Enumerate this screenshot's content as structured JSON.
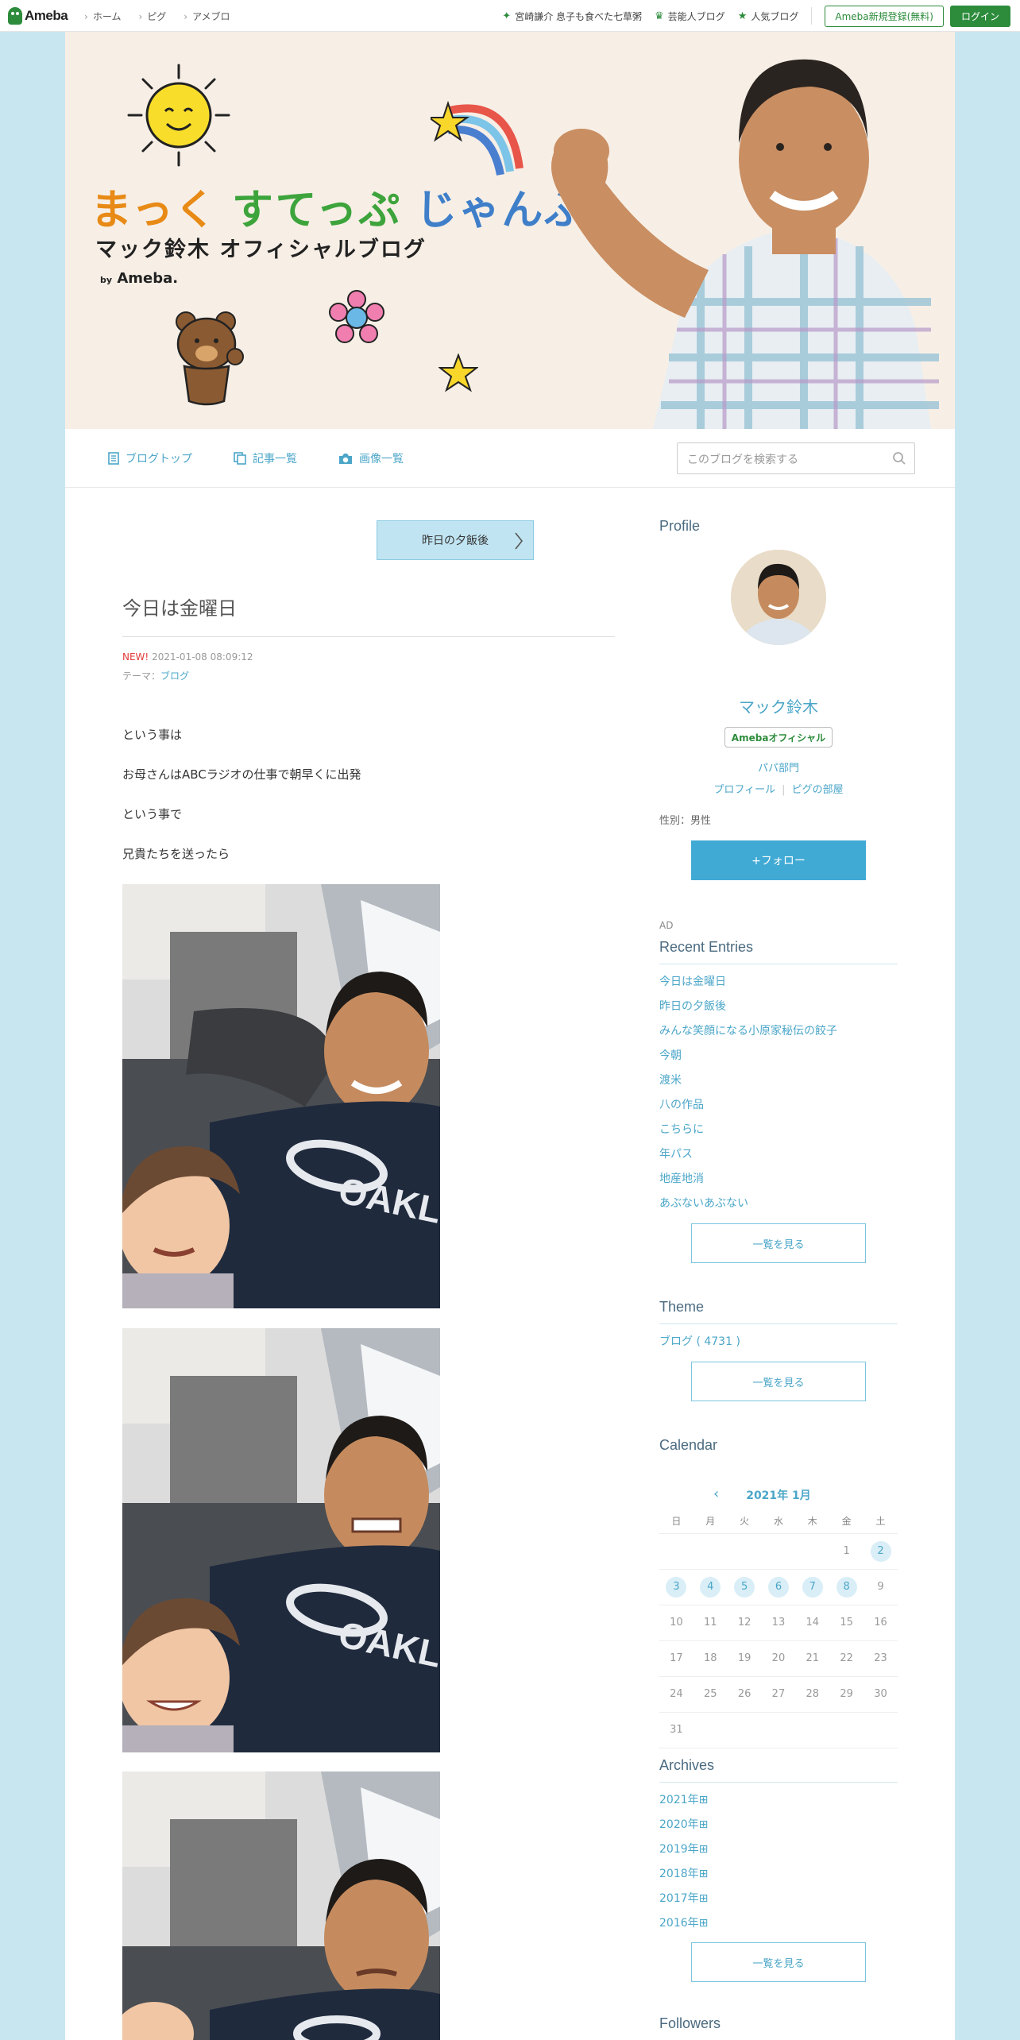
{
  "topbar": {
    "logo": "Ameba",
    "nav": [
      "ホーム",
      "ピグ",
      "アメブロ"
    ],
    "right_links": [
      "宮崎謙介 息子も食べた七草粥",
      "芸能人ブログ",
      "人気ブログ"
    ],
    "register": "Ameba新規登録(無料)",
    "login": "ログイン"
  },
  "banner": {
    "title_parts": [
      "まっく",
      "すてっぷ",
      "じゃんぷ"
    ],
    "subtitle": "マック鈴木 オフィシャルブログ",
    "by_prefix": "by",
    "by_brand": "Ameba."
  },
  "blognav": {
    "items": [
      "ブログトップ",
      "記事一覧",
      "画像一覧"
    ],
    "search_placeholder": "このブログを検索する"
  },
  "entry": {
    "prev_label": "昨日の夕飯後",
    "title": "今日は金曜日",
    "new": "NEW!",
    "date": "2021-01-08 08:09:12",
    "theme_label": "テーマ：",
    "theme": "ブログ",
    "paragraphs": [
      "という事は",
      "お母さんはABCラジオの仕事で朝早くに出発",
      "という事で",
      "兄貴たちを送ったら"
    ],
    "shirt_text": "OAKLEY"
  },
  "profile": {
    "heading": "Profile",
    "name": "マック鈴木",
    "badge": "Amebaオフィシャル",
    "category": "パパ部門",
    "link_profile": "プロフィール",
    "link_pig": "ピグの部屋",
    "gender": "性別：男性",
    "follow": "+フォロー",
    "ad": "AD"
  },
  "recent": {
    "heading": "Recent Entries",
    "items": [
      "今日は金曜日",
      "昨日の夕飯後",
      "みんな笑顔になる小原家秘伝の餃子",
      "今朝",
      "渡米",
      "八の作品",
      "こちらに",
      "年パス",
      "地産地消",
      "あぶないあぶない"
    ],
    "more": "一覧を見る"
  },
  "theme": {
    "heading": "Theme",
    "item": "ブログ ( 4731 )",
    "more": "一覧を見る"
  },
  "calendar": {
    "heading": "Calendar",
    "month": "2021年 1月",
    "weekdays": [
      "日",
      "月",
      "火",
      "水",
      "木",
      "金",
      "土"
    ],
    "weeks": [
      [
        "",
        "",
        "",
        "",
        "",
        "1",
        "2"
      ],
      [
        "3",
        "4",
        "5",
        "6",
        "7",
        "8",
        "9"
      ],
      [
        "10",
        "11",
        "12",
        "13",
        "14",
        "15",
        "16"
      ],
      [
        "17",
        "18",
        "19",
        "20",
        "21",
        "22",
        "23"
      ],
      [
        "24",
        "25",
        "26",
        "27",
        "28",
        "29",
        "30"
      ],
      [
        "31",
        "",
        "",
        "",
        "",
        "",
        ""
      ]
    ],
    "highlighted": [
      "2",
      "3",
      "4",
      "5",
      "6",
      "7",
      "8"
    ]
  },
  "archives": {
    "heading": "Archives",
    "items": [
      "2021年",
      "2020年",
      "2019年",
      "2018年",
      "2017年",
      "2016年"
    ],
    "more": "一覧を見る"
  },
  "followers": {
    "heading": "Followers"
  },
  "colors": {
    "page_bg": "#c8e6f0",
    "accent_blue": "#4ba6c8",
    "ameba_green": "#2d8c3c",
    "follow_button": "#41aad4"
  }
}
